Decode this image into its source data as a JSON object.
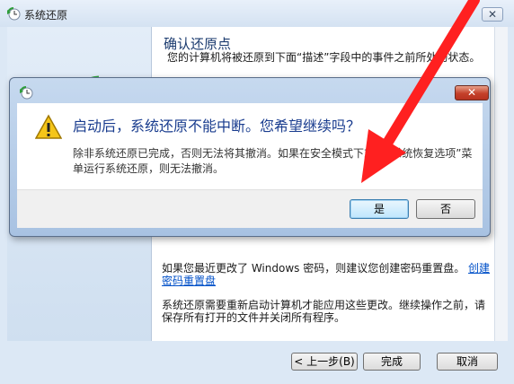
{
  "window": {
    "title": "系统还原",
    "close_glyph": "✕"
  },
  "page": {
    "heading": "确认还原点",
    "description": "您的计算机将被还原到下面“描述”字段中的事件之前所处的状态。",
    "password_text": "如果您最近更改了 Windows 密码，则建议您创建密码重置盘。",
    "password_link": "创建密码重置盘",
    "restart_text": "系统还原需要重新启动计算机才能应用这些更改。继续操作之前，请保存所有打开的文件并关闭所有程序。"
  },
  "footer": {
    "back_label": "< 上一步(B)",
    "finish_label": "完成",
    "cancel_label": "取消"
  },
  "dialog": {
    "question": "启动后，系统还原不能中断。您希望继续吗？",
    "detail": "除非系统还原已完成，否则无法将其撤消。如果在安全模式下或从“系统恢复选项”菜单运行系统还原，则无法撤消。",
    "yes_label": "是",
    "no_label": "否",
    "close_glyph": "✕"
  },
  "icons": {
    "window_icon": "system-restore-icon",
    "dialog_icon": "system-restore-icon",
    "warning": "warning-icon",
    "clock": "restore-clock-icon"
  },
  "colors": {
    "accent": "#1a3d8f",
    "arrow": "#ff2020",
    "close_red": "#c4402a"
  }
}
